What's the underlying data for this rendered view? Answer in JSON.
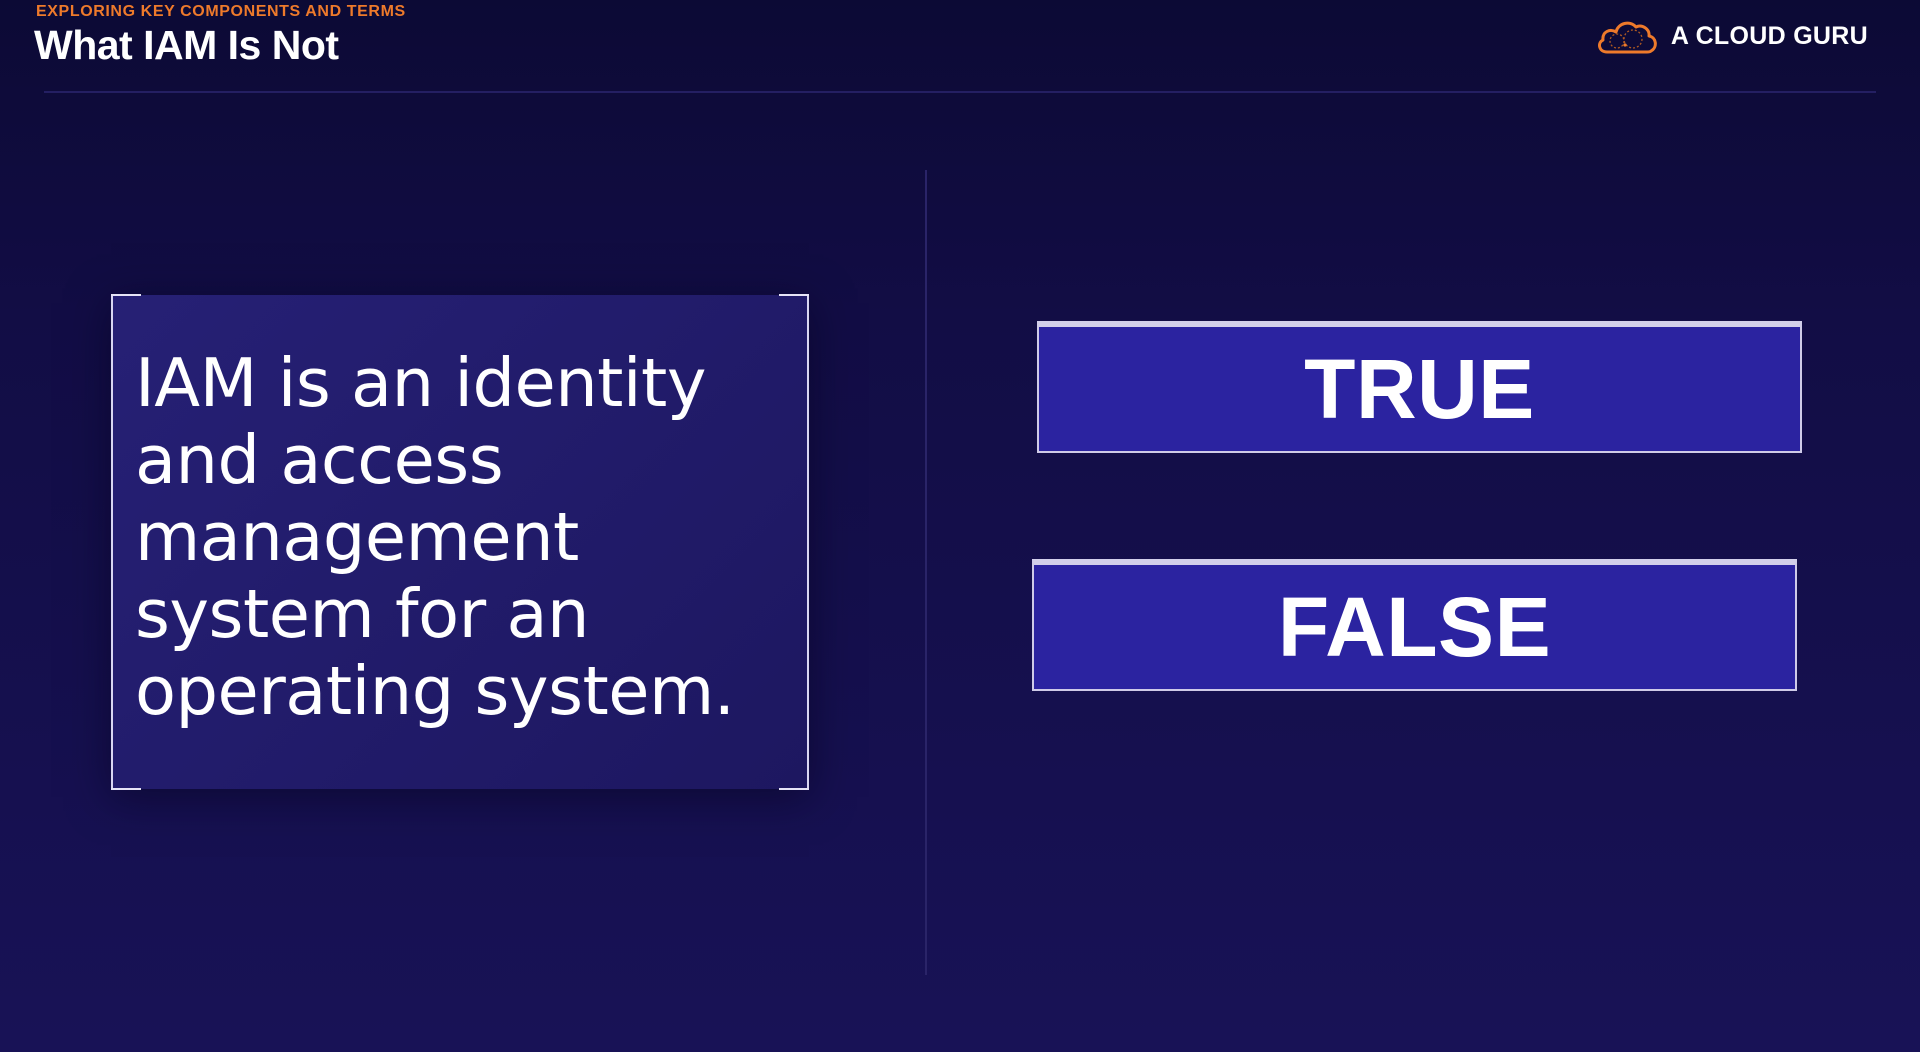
{
  "header": {
    "kicker": "EXPLORING KEY COMPONENTS AND TERMS",
    "title": "What IAM Is Not"
  },
  "brand": {
    "name": "A CLOUD GURU",
    "icon": "cloud-icon",
    "accent_color": "#ee7a2b"
  },
  "question": {
    "text": "IAM is an identity and access management system for an operating system."
  },
  "answers": [
    {
      "label": "TRUE"
    },
    {
      "label": "FALSE"
    }
  ],
  "colors": {
    "background": "#120d45",
    "card": "#221b6a",
    "answer_fill": "#2b23a0",
    "accent": "#ee7a2b"
  }
}
